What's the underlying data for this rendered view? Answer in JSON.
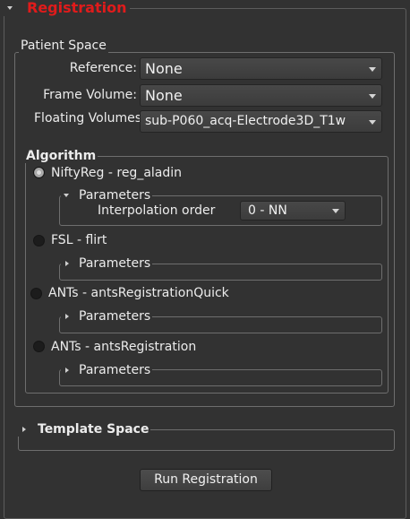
{
  "registration": {
    "title": "Registration",
    "title_color": "#e01b1b",
    "patient_space": {
      "title": "Patient Space",
      "reference_label": "Reference:",
      "reference_value": "None",
      "frame_volume_label": "Frame Volume:",
      "frame_volume_value": "None",
      "floating_volumes_label": "Floating Volumes",
      "floating_volumes_value": "sub-P060_acq-Electrode3D_T1w"
    },
    "algorithm": {
      "title": "Algorithm",
      "options": [
        {
          "label": "NiftyReg  - reg_aladin",
          "checked": true,
          "parameters_label": "Parameters",
          "expanded": true,
          "interpolation_label": "Interpolation order",
          "interpolation_value": "0 - NN"
        },
        {
          "label": "FSL - flirt",
          "checked": false,
          "parameters_label": "Parameters",
          "expanded": false
        },
        {
          "label": "ANTs - antsRegistrationQuick",
          "checked": false,
          "parameters_label": "Parameters",
          "expanded": false
        },
        {
          "label": "ANTs - antsRegistration",
          "checked": false,
          "parameters_label": "Parameters",
          "expanded": false
        }
      ]
    },
    "template_space": {
      "title": "Template Space",
      "expanded": false
    },
    "run_button": "Run Registration"
  }
}
